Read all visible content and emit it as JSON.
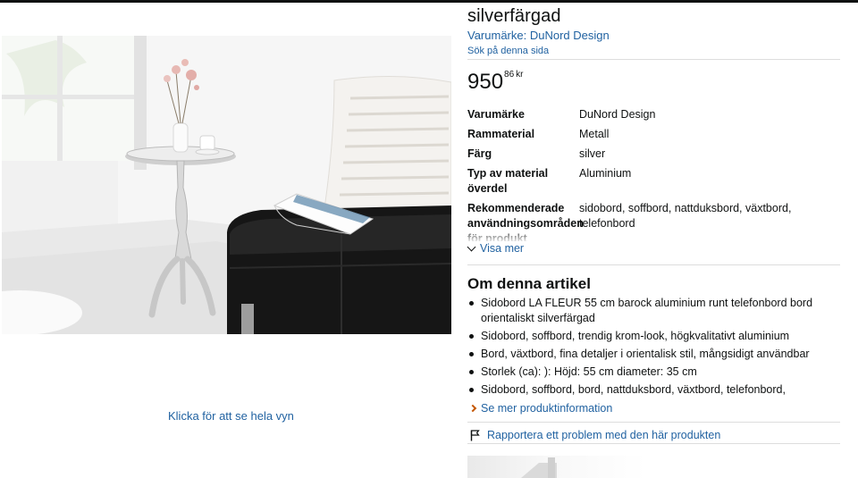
{
  "product": {
    "title": "silverfärgad",
    "brand_link": "Varumärke: DuNord Design",
    "search_link": "Sök på denna sida",
    "price_whole": "950",
    "price_fraction": "86",
    "price_currency": "kr",
    "view_full_link": "Klicka för att se hela vyn"
  },
  "specs": [
    {
      "key": "Varumärke",
      "value": "DuNord Design"
    },
    {
      "key": "Rammaterial",
      "value": "Metall"
    },
    {
      "key": "Färg",
      "value": "silver"
    },
    {
      "key": "Typ av material överdel",
      "value": "Aluminium"
    },
    {
      "key": "Rekommenderade användningsområden för produkt",
      "value": "sidobord, soffbord, nattduksbord, växtbord, telefonbord"
    }
  ],
  "show_more": "Visa mer",
  "about": {
    "heading": "Om denna artikel",
    "bullets": [
      "Sidobord LA FLEUR 55 cm barock aluminium runt telefonbord bord orientaliskt silverfärgad",
      "Sidobord, soffbord, trendig krom-look, högkvalitativt aluminium",
      "Bord, växtbord, fina detaljer i orientalisk stil, mångsidigt användbar",
      "Storlek (ca): ): Höjd: 55 cm diameter: 35 cm",
      "Sidobord, soffbord, bord, nattduksbord, växtbord, telefonbord,"
    ],
    "see_more": "Se mer produktinformation"
  },
  "report_link": "Rapportera ett problem med den här produkten",
  "colors": {
    "link": "#2162a1",
    "text": "#0f1111",
    "accent_chevron": "#c45500",
    "divider": "#dddddd"
  },
  "icons": [
    "chevron-down-icon",
    "chevron-right-icon",
    "flag-icon"
  ]
}
